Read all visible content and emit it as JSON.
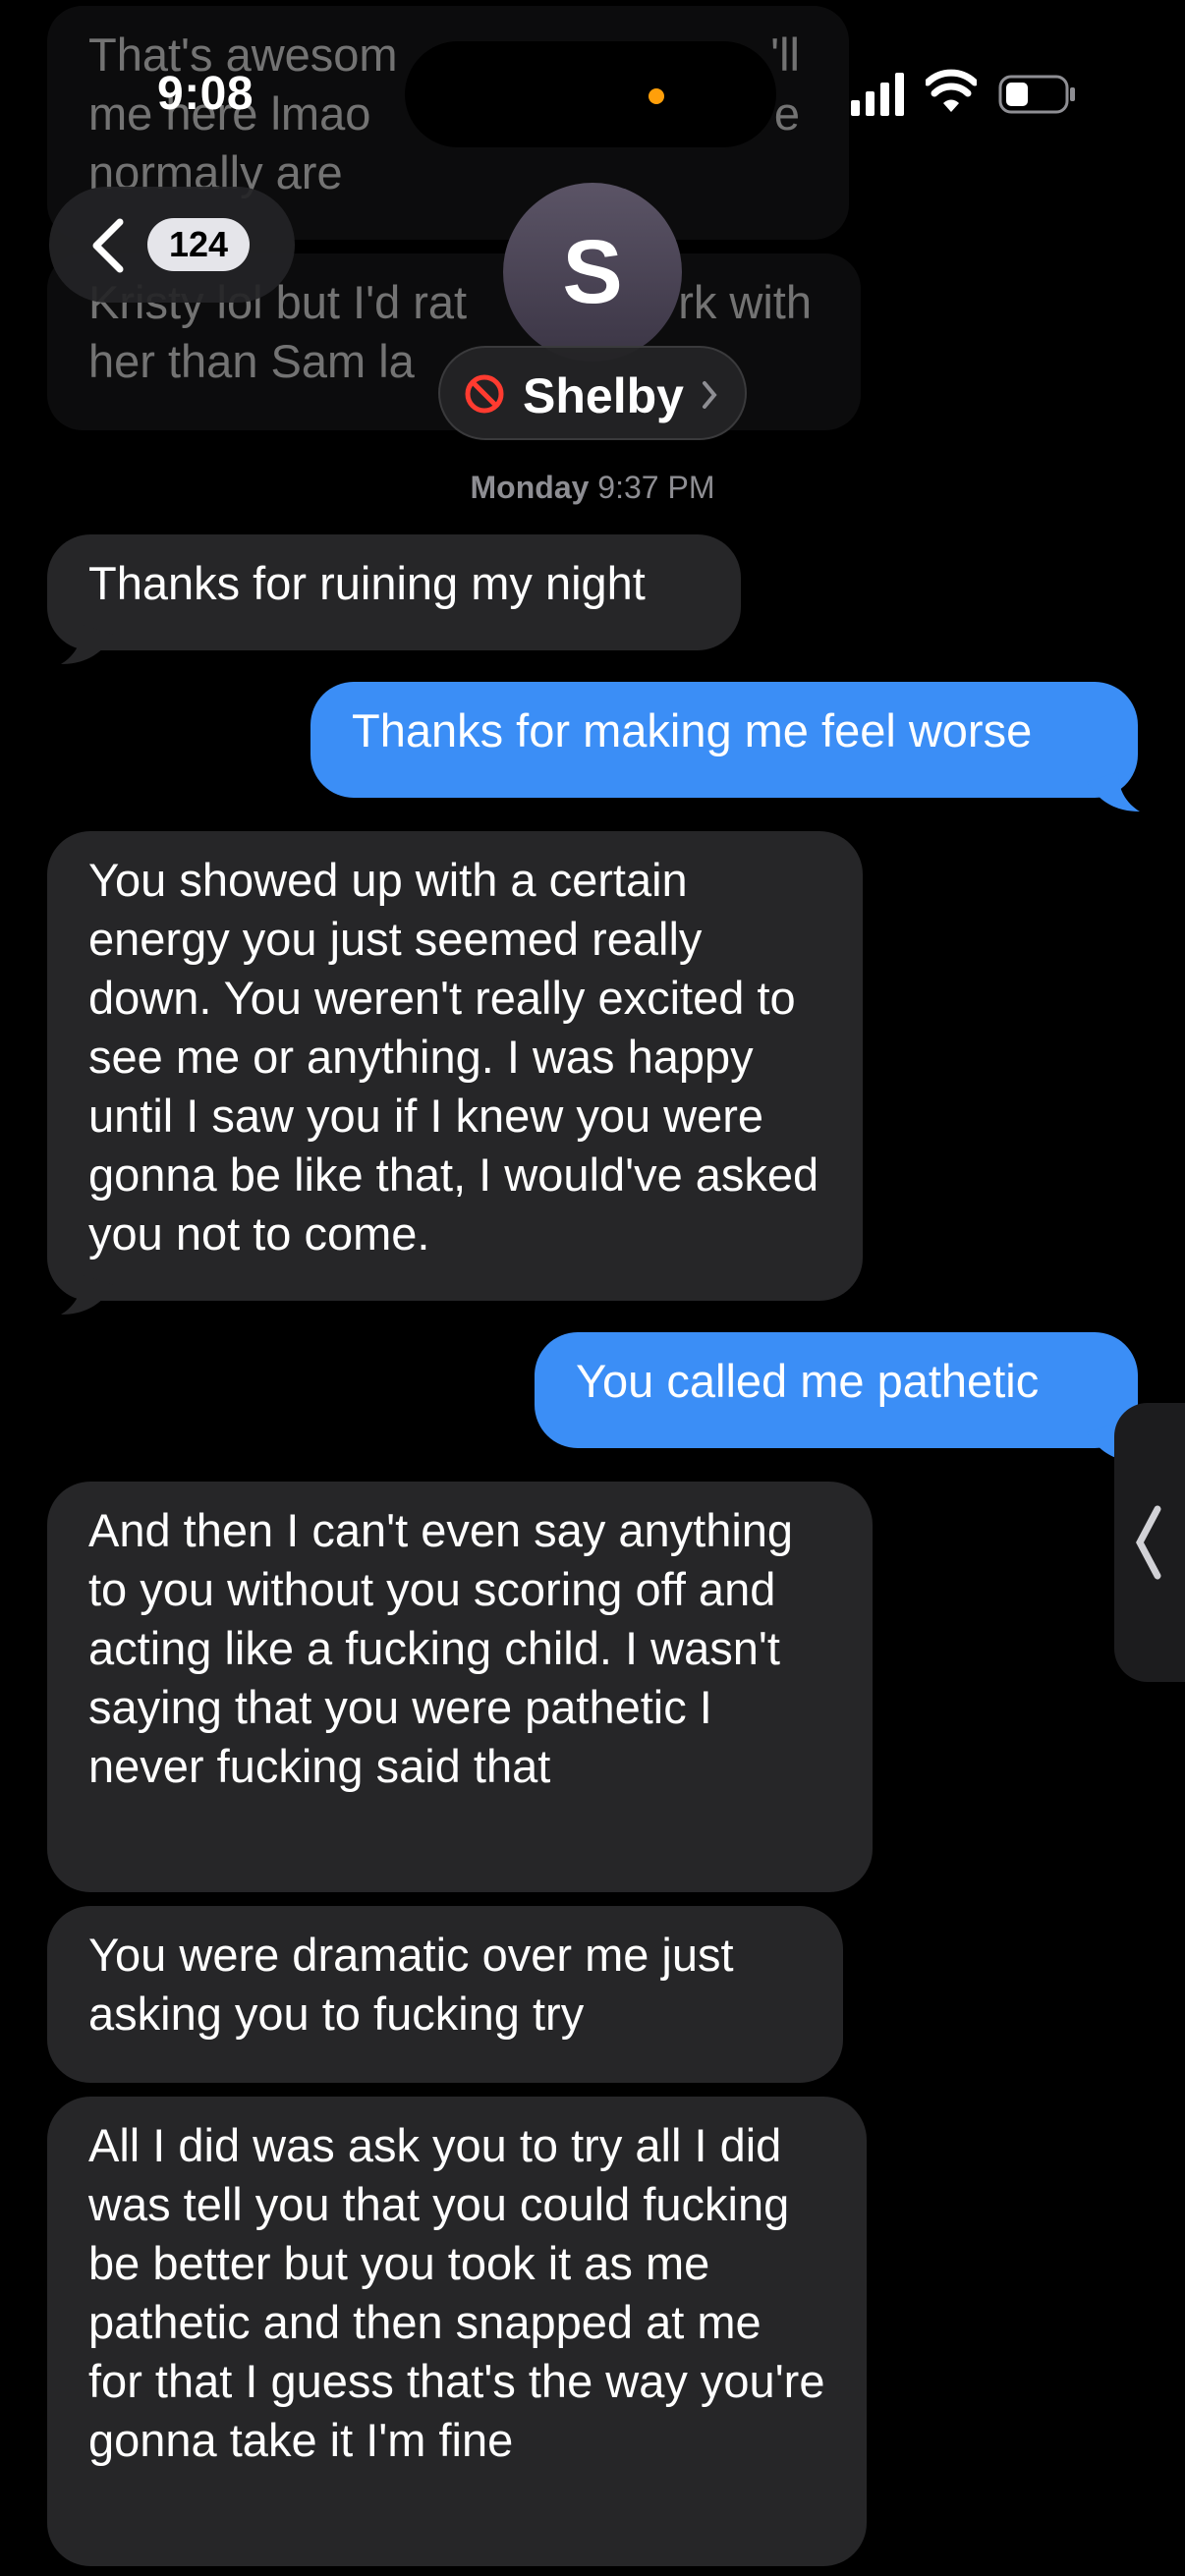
{
  "status_bar": {
    "time": "9:08"
  },
  "header": {
    "back_count": "124",
    "avatar_initial": "S",
    "contact_name": "Shelby"
  },
  "faded_messages": [
    {
      "lines": [
        "That's awesom",
        "me here lmao",
        "normally are"
      ],
      "right_fragment_1": "'ll",
      "right_fragment_2": "e"
    },
    {
      "lines": [
        "Kristy lol but I'd rat",
        "her than Sam la"
      ],
      "right_fragment_1": "rk with"
    }
  ],
  "timestamp": {
    "day": "Monday",
    "time": "9:37 PM"
  },
  "messages": [
    {
      "direction": "incoming",
      "text": "Thanks for ruining my night"
    },
    {
      "direction": "outgoing",
      "text": "Thanks for making me feel worse"
    },
    {
      "direction": "incoming",
      "text": "You showed up with a certain energy you just seemed really down. You weren't really excited to see me or anything. I was happy until I saw you if I knew you were gonna be like that, I would've asked you not to come."
    },
    {
      "direction": "outgoing",
      "text": "You called me pathetic"
    },
    {
      "direction": "incoming",
      "text": "And then I can't even say anything to you without you scoring off and acting like a fucking child. I wasn't saying that you were pathetic I never fucking said that"
    },
    {
      "direction": "incoming",
      "text": "You were dramatic over me just asking you to fucking try"
    },
    {
      "direction": "incoming",
      "text": "All I did was ask you to try all I did was tell you that you could fucking be better but you took it as me pathetic and then snapped at me for that I guess that's the way you're gonna take it I'm fine"
    }
  ],
  "colors": {
    "outgoing": "#3b8ef6",
    "incoming": "#262628",
    "background": "#000000",
    "orange_dot": "#ff9f0a"
  },
  "icons": [
    "back-chevron-icon",
    "block-icon",
    "chevron-right-icon",
    "signal-icon",
    "wifi-icon",
    "battery-icon",
    "side-chevron-icon"
  ]
}
